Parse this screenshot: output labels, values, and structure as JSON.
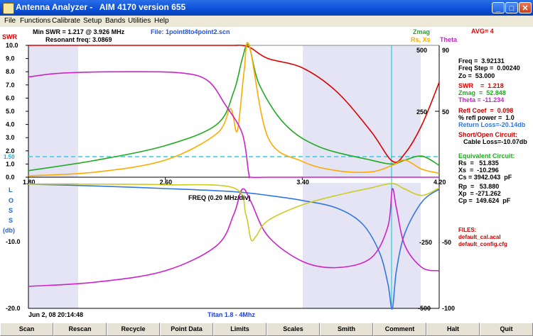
{
  "window": {
    "title": "Antenna Analyzer -   AIM 4170 version 655"
  },
  "menu": [
    "File",
    "Functions",
    "Calibrate",
    "Setup",
    "Bands",
    "Utilities",
    "Help"
  ],
  "header": {
    "swr_label": "SWR",
    "min_swr": "Min SWR = 1.217 @ 3.926 MHz",
    "resonant": "Resonant freq:  3.0869",
    "file": "File: 1point8to4point2.scn",
    "zmag": "Zmag",
    "rsxs": "Rs, Xs",
    "theta": "Theta",
    "avg": "AVG= 4"
  },
  "axes": {
    "swr_ticks": [
      "10.0",
      "9.0",
      "8.0",
      "7.0",
      "6.0",
      "5.0",
      "4.0",
      "3.0",
      "2.0",
      "1.0",
      "0.0"
    ],
    "swr_ref": "1.50",
    "z_ticks": [
      "500",
      "250"
    ],
    "theta_ticks": [
      "90",
      "50"
    ],
    "rl_label": [
      "L",
      "O",
      "S",
      "S",
      "(db)"
    ],
    "rl_ticks": [
      "-10.0",
      "-20.0"
    ],
    "x_ticks": [
      "1.80",
      "2.60",
      "3.40",
      "4.20"
    ],
    "x_label": "FREQ (0.20 MHz/div)",
    "lower_right_ticks": [
      "-250",
      "-50",
      "-500",
      "-100"
    ]
  },
  "footer": {
    "date": "Jun 2, 08  20:14:48",
    "model": "Titan 1.8 - 4Mhz"
  },
  "readout": {
    "freq": "Freq =  3.92131",
    "step": "Freq Step =  0.00240",
    "zo": "Zo =  53.000",
    "swr": "SWR    =  1.218",
    "zmag": "Zmag  =  52.848",
    "theta": "Theta = -11.234",
    "refl": "Refl Coef  =  0.098",
    "refl_pow": "% refl power =  1.0",
    "return_loss": "Return Loss=-20.14db",
    "short_open": "Short/Open Circuit:",
    "cable_loss": "Cable Loss=-10.07db",
    "equiv": "Equivalent Circuit:",
    "rs": "Rs  =   51.835",
    "xs": "Xs  =  -10.296",
    "cs": "Cs = 3942.043  pF",
    "rp": "Rp  =   53.880",
    "xp": "Xp  = -271.262",
    "cp": "Cp =  149.624  pF",
    "files": "FILES:",
    "cal": "default_cal.acal",
    "config": "default_config.cfg"
  },
  "buttons": [
    "Scan",
    "Rescan",
    "Recycle",
    "Point Data",
    "Limits",
    "Scales",
    "Smith",
    "Comment",
    "Halt",
    "Quit"
  ],
  "colors": {
    "swr": "#dd0000",
    "zmag": "#22aa22",
    "rsxs": "#ffaa00",
    "theta": "#cc22cc",
    "return_loss": "#3377dd",
    "xs_lower": "#cccc22",
    "cursor": "#00cccc",
    "band": "#e4e4f4"
  },
  "chart_data": [
    {
      "type": "line",
      "title": "",
      "xlabel": "FREQ (0.20 MHz/div)",
      "ylabel": "SWR",
      "xlim": [
        1.8,
        4.2
      ],
      "ylim": [
        0,
        10
      ],
      "series": [
        {
          "name": "SWR",
          "x": [
            1.8,
            2.2,
            2.6,
            2.9,
            3.0,
            3.05,
            3.1,
            3.2,
            3.4,
            3.6,
            3.8,
            3.926,
            4.0,
            4.1,
            4.2
          ],
          "y": [
            10,
            10,
            10,
            10,
            10,
            10,
            9.8,
            9,
            8.3,
            6.5,
            3.5,
            1.22,
            1.8,
            4,
            7.2
          ]
        },
        {
          "name": "Zmag",
          "x": [
            1.8,
            2.2,
            2.6,
            2.9,
            3.0,
            3.05,
            3.087,
            3.15,
            3.3,
            3.5,
            3.8,
            3.926,
            4.0,
            4.1,
            4.2
          ],
          "y": [
            0.5,
            1.3,
            2.4,
            4,
            6.5,
            9,
            10,
            7,
            4,
            2.3,
            1.3,
            1.0,
            1.3,
            1.6,
            0.9
          ]
        },
        {
          "name": "Rs, Xs",
          "x": [
            1.8,
            2.2,
            2.6,
            2.9,
            2.98,
            3.02,
            3.06,
            3.09,
            3.2,
            3.4,
            3.6,
            3.8,
            3.926,
            4.0,
            4.1,
            4.2
          ],
          "y": [
            0.1,
            0.4,
            1.3,
            3.3,
            5.2,
            3.5,
            8,
            10,
            3,
            1.2,
            0.5,
            0.4,
            0.9,
            1.3,
            0.6,
            0.3
          ]
        },
        {
          "name": "Theta",
          "x": [
            1.8,
            2.0,
            2.4,
            2.7,
            2.85,
            2.95,
            3.05,
            3.087,
            3.1,
            3.2,
            3.4,
            3.6,
            3.8,
            4.0,
            4.2
          ],
          "y": [
            7.6,
            7.9,
            8.0,
            7.9,
            7.3,
            5.5,
            3.3,
            0.3,
            0,
            0,
            0,
            0,
            0,
            0,
            0
          ]
        }
      ]
    },
    {
      "type": "line",
      "title": "",
      "xlabel": "FREQ (0.20 MHz/div)",
      "ylabel": "LOSS (db)",
      "xlim": [
        1.8,
        4.2
      ],
      "ylim": [
        -20,
        0
      ],
      "series": [
        {
          "name": "Return Loss",
          "x": [
            1.8,
            2.2,
            2.6,
            3.0,
            3.2,
            3.4,
            3.6,
            3.75,
            3.85,
            3.9,
            3.926,
            3.95,
            4.0,
            4.1,
            4.2
          ],
          "y": [
            -0.2,
            -0.5,
            -0.9,
            -1.4,
            -2,
            -2.8,
            -4,
            -6.5,
            -11,
            -16,
            -20.1,
            -14,
            -8,
            -3,
            -1
          ]
        },
        {
          "name": "Theta (lower)",
          "x": [
            1.8,
            2.2,
            2.6,
            2.9,
            3.0,
            3.05,
            3.1,
            3.2,
            3.4,
            3.6,
            3.8,
            3.9,
            3.926,
            3.95,
            4.0,
            4.1,
            4.2
          ],
          "y": [
            -16.5,
            -15.8,
            -14,
            -10,
            -5,
            -1,
            -3,
            -8.5,
            -12.5,
            -13.5,
            -12,
            -7,
            -1,
            -4,
            -10,
            -13.5,
            -14
          ]
        },
        {
          "name": "Xs (lower)",
          "x": [
            1.8,
            2.2,
            2.6,
            3.0,
            3.07,
            3.1,
            3.13,
            3.2,
            3.4,
            3.6,
            3.8,
            3.926,
            4.0,
            4.1,
            4.2
          ],
          "y": [
            -0.2,
            -0.2,
            -0.3,
            -0.8,
            -5,
            -9,
            -8.5,
            -6,
            -3.5,
            -2,
            -0.8,
            -0.1,
            -1,
            -2,
            -0.8
          ]
        }
      ]
    }
  ]
}
